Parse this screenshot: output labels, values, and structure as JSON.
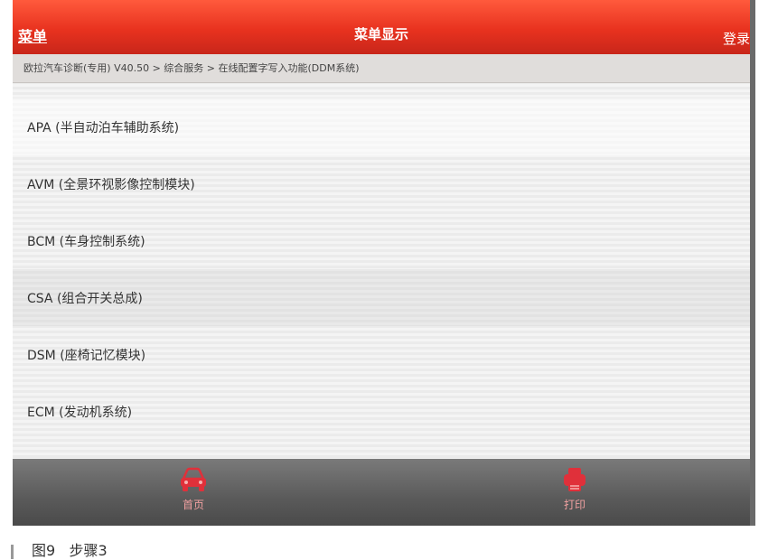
{
  "header": {
    "menu_label": "菜单",
    "title": "菜单显示",
    "login_label": "登录"
  },
  "breadcrumb": "欧拉汽车诊断(专用) V40.50 > 综合服务 > 在线配置字写入功能(DDM系统)",
  "list": [
    {
      "label": "APA (半自动泊车辅助系统)"
    },
    {
      "label": "AVM (全景环视影像控制模块)"
    },
    {
      "label": "BCM (车身控制系统)"
    },
    {
      "label": "CSA (组合开关总成)"
    },
    {
      "label": "DSM (座椅记忆模块)"
    },
    {
      "label": "ECM (发动机系统)"
    }
  ],
  "footer": {
    "home_label": "首页",
    "print_label": "打印"
  },
  "caption": {
    "figure": "图9",
    "text": "步骤3"
  },
  "colors": {
    "header_red": "#e8321f",
    "footer_gray": "#5a5a5a",
    "icon_red": "#e0303a"
  }
}
